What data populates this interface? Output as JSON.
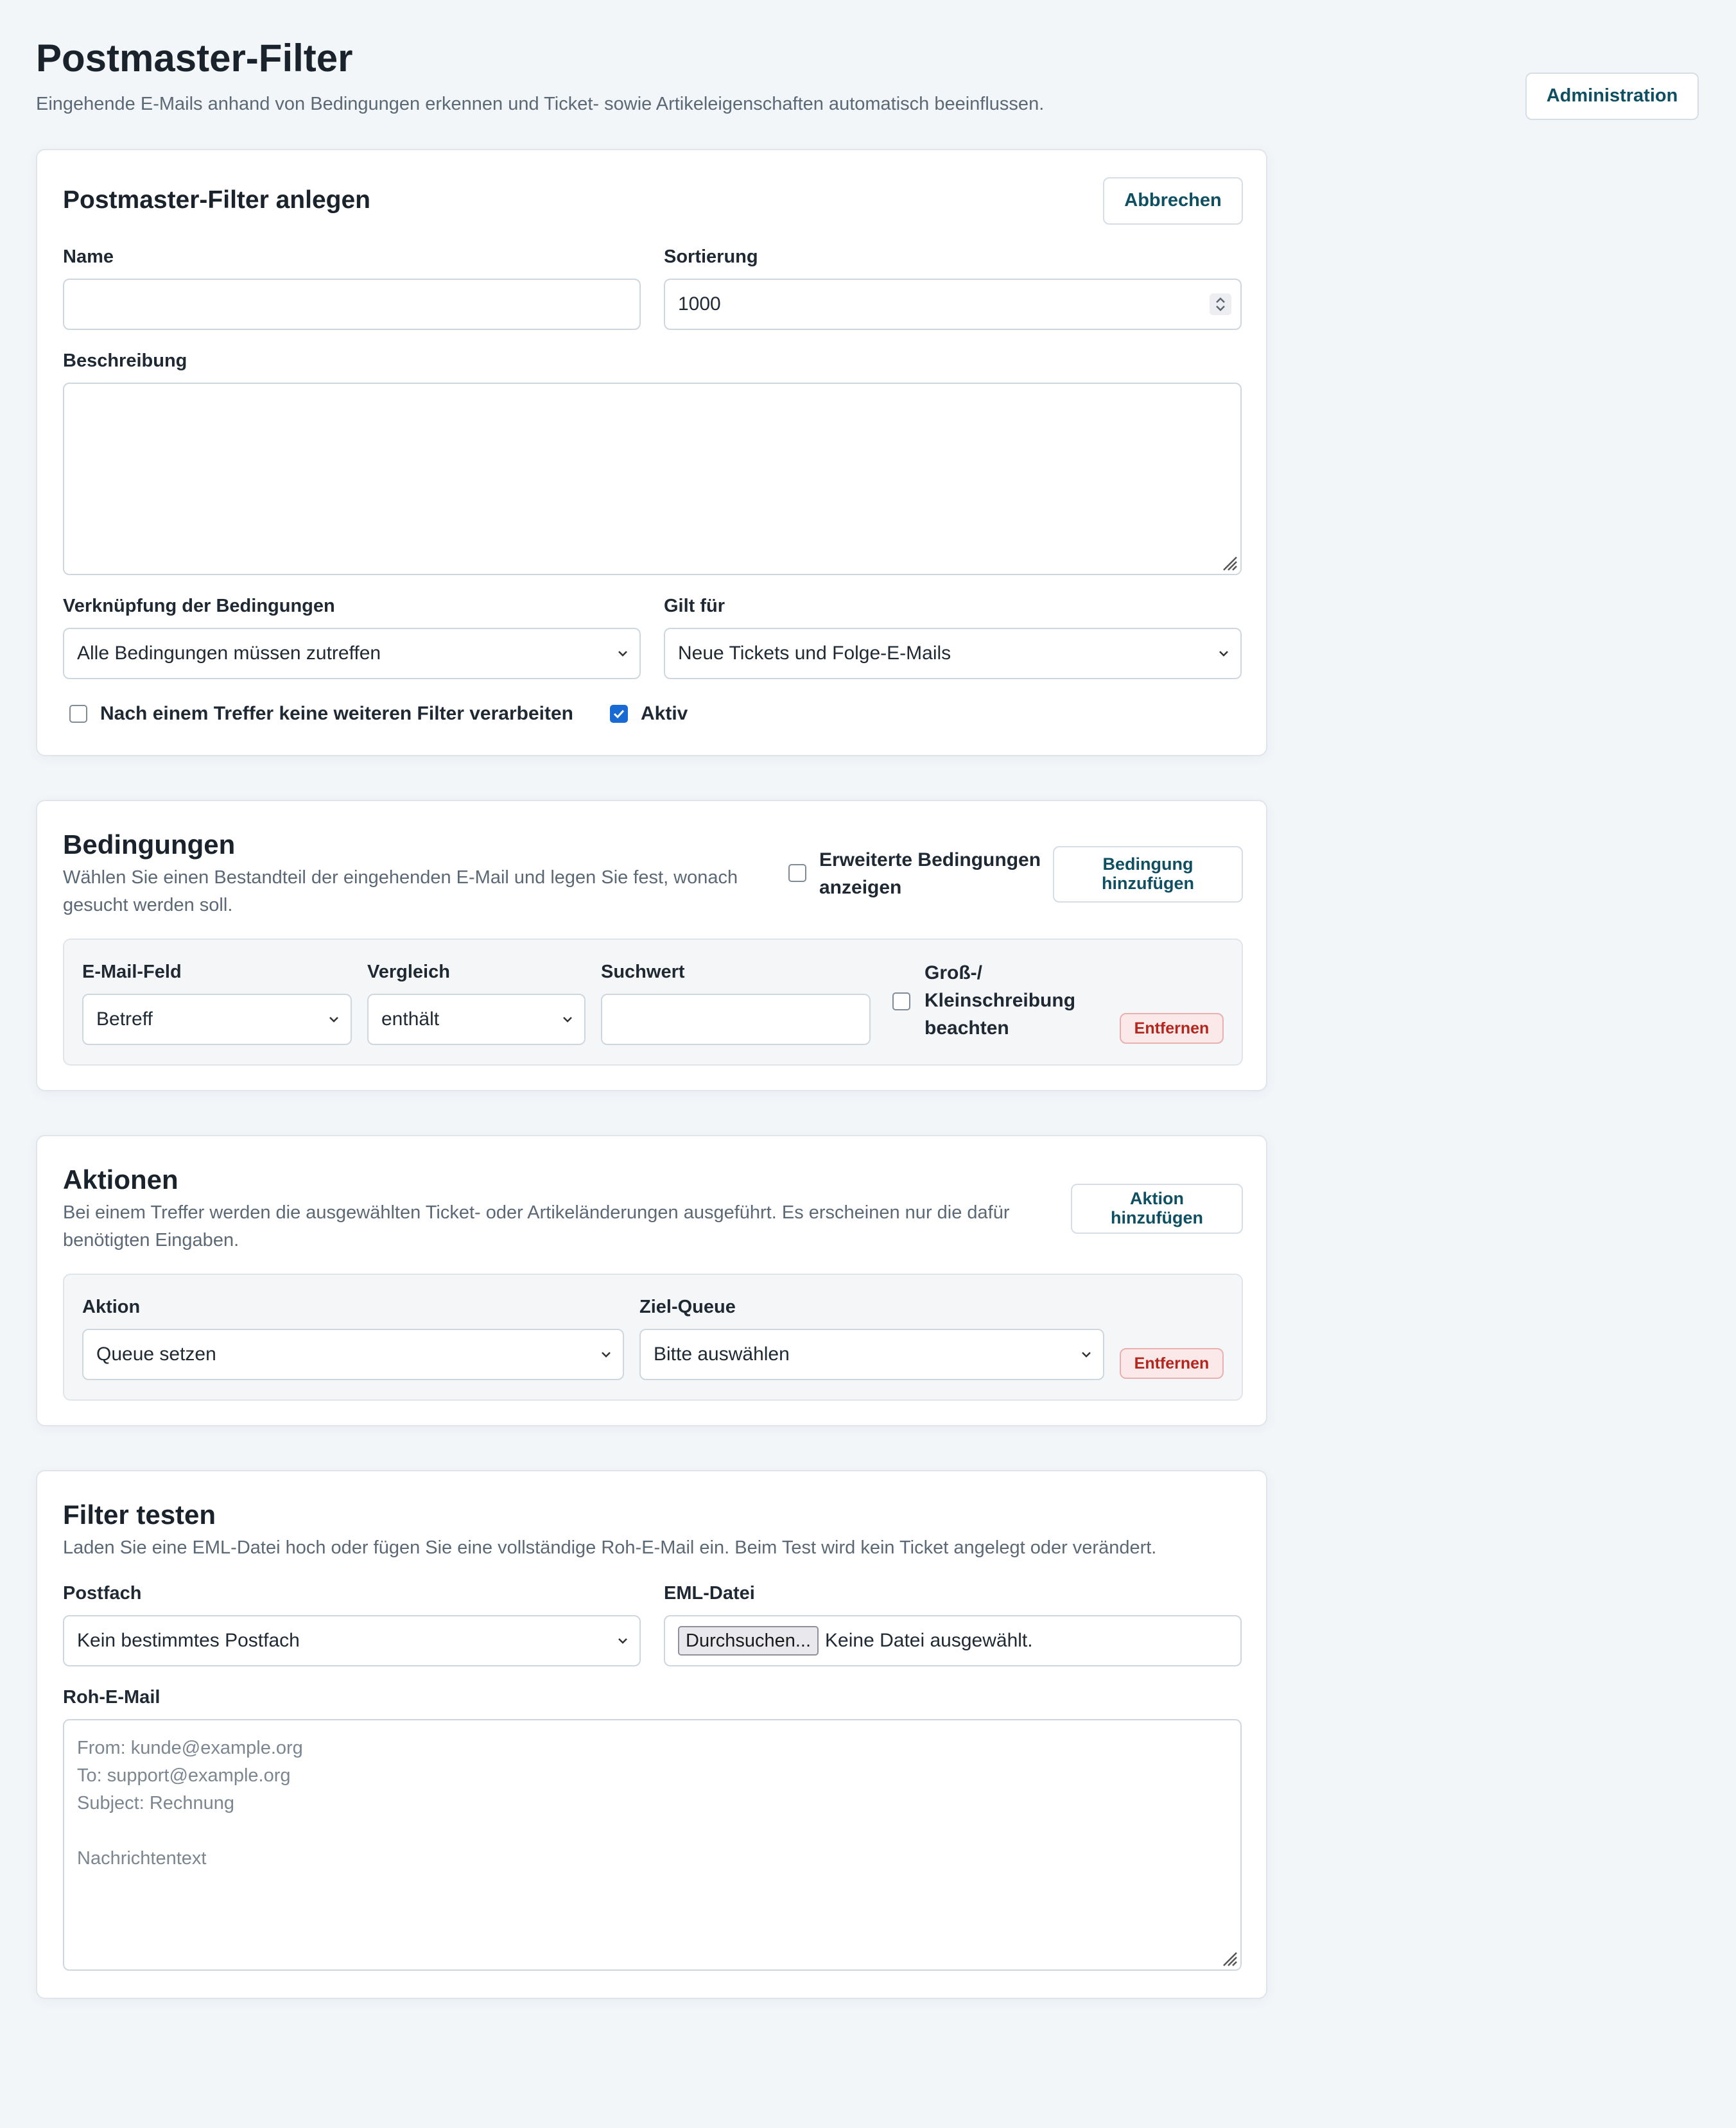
{
  "header": {
    "title": "Postmaster-Filter",
    "subtitle": "Eingehende E-Mails anhand von Bedingungen erkennen und Ticket- sowie Artikeleigenschaften automatisch beeinflussen.",
    "admin_label": "Administration"
  },
  "create": {
    "title": "Postmaster-Filter anlegen",
    "cancel_label": "Abbrechen",
    "name_label": "Name",
    "name_value": "",
    "sort_label": "Sortierung",
    "sort_value": "1000",
    "desc_label": "Beschreibung",
    "desc_value": "",
    "link_label": "Verknüpfung der Bedingungen",
    "link_value": "Alle Bedingungen müssen zutreffen",
    "applies_label": "Gilt für",
    "applies_value": "Neue Tickets und Folge-E-Mails",
    "stop_label": "Nach einem Treffer keine weiteren Filter verarbeiten",
    "stop_checked": false,
    "active_label": "Aktiv",
    "active_checked": true
  },
  "conditions": {
    "title": "Bedingungen",
    "description": "Wählen Sie einen Bestandteil der eingehenden E-Mail und legen Sie fest, wonach gesucht werden soll.",
    "advanced_label": "Erweiterte Bedingungen anzeigen",
    "add_label": "Bedingung hinzufügen",
    "row": {
      "field_label": "E-Mail-Feld",
      "field_value": "Betreff",
      "compare_label": "Vergleich",
      "compare_value": "enthält",
      "search_label": "Suchwert",
      "search_value": "",
      "case_label": "Groß-/ Kleinschreibung beachten",
      "remove_label": "Entfernen"
    }
  },
  "actions": {
    "title": "Aktionen",
    "description": "Bei einem Treffer werden die ausgewählten Ticket- oder Artikeländerungen ausgeführt. Es erscheinen nur die dafür benötigten Eingaben.",
    "add_label": "Aktion hinzufügen",
    "row": {
      "action_label": "Aktion",
      "action_value": "Queue setzen",
      "queue_label": "Ziel-Queue",
      "queue_value": "Bitte auswählen",
      "remove_label": "Entfernen"
    }
  },
  "test": {
    "title": "Filter testen",
    "description": "Laden Sie eine EML-Datei hoch oder fügen Sie eine vollständige Roh-E-Mail ein. Beim Test wird kein Ticket angelegt oder verändert.",
    "mailbox_label": "Postfach",
    "mailbox_value": "Kein bestimmtes Postfach",
    "eml_label": "EML-Datei",
    "browse_label": "Durchsuchen...",
    "no_file_label": "Keine Datei ausgewählt.",
    "raw_label": "Roh-E-Mail",
    "raw_placeholder": "From: kunde@example.org\nTo: support@example.org\nSubject: Rechnung\n\nNachrichtentext"
  },
  "colors": {
    "accent": "#0e4f62",
    "checkbox_on": "#1a6ad4",
    "danger": "#b3261e",
    "background": "#f3f6f9"
  }
}
